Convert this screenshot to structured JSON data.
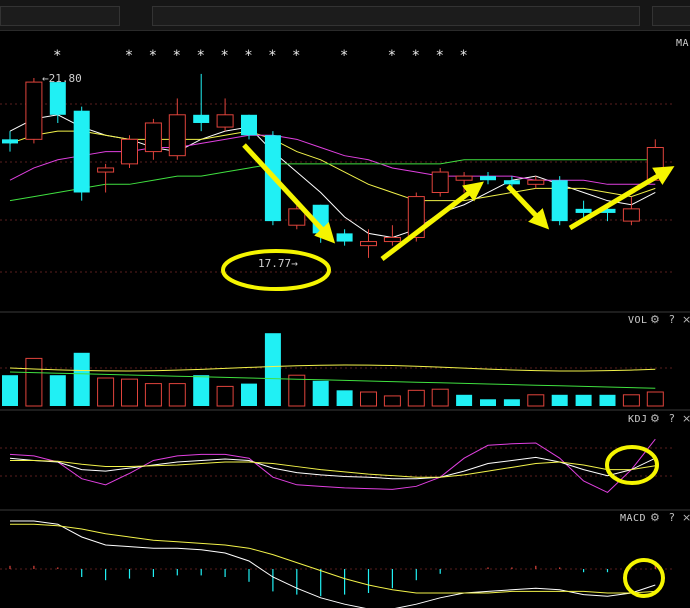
{
  "panels": {
    "main": {
      "label": "MA"
    },
    "vol": {
      "label": "VOL"
    },
    "kdj": {
      "label": "KDJ"
    },
    "macd": {
      "label": "MACD"
    }
  },
  "panel_controls": {
    "settings": "⚙",
    "help": "?",
    "close": "×"
  },
  "annotations": {
    "high_price": "21.80",
    "low_price": "17.77",
    "high_arrow": "←",
    "low_arrow": "→",
    "star": "*"
  },
  "colors": {
    "up": "#e0443c",
    "down": "#20f0f4",
    "ma_white": "#ffffff",
    "ma_yellow": "#f2f24a",
    "ma_magenta": "#e040e0",
    "ma_green": "#40e040",
    "highlight": "#f5f500",
    "grid": "#5a1e1e"
  },
  "chart_data": {
    "type": "candlestick",
    "candles": [
      {
        "o": 20.3,
        "c": 20.2,
        "h": 20.5,
        "l": 20.0,
        "dir": "down"
      },
      {
        "o": 20.3,
        "c": 21.7,
        "h": 21.8,
        "l": 20.2,
        "dir": "up"
      },
      {
        "o": 21.7,
        "c": 20.9,
        "h": 21.7,
        "l": 20.7,
        "dir": "down"
      },
      {
        "o": 21.0,
        "c": 19.0,
        "h": 21.1,
        "l": 18.8,
        "dir": "down"
      },
      {
        "o": 19.5,
        "c": 19.6,
        "h": 19.7,
        "l": 19.0,
        "dir": "up"
      },
      {
        "o": 19.7,
        "c": 20.3,
        "h": 20.4,
        "l": 19.6,
        "dir": "up"
      },
      {
        "o": 20.0,
        "c": 20.7,
        "h": 20.8,
        "l": 19.8,
        "dir": "up"
      },
      {
        "o": 19.9,
        "c": 20.9,
        "h": 21.3,
        "l": 19.8,
        "dir": "up"
      },
      {
        "o": 20.9,
        "c": 20.7,
        "h": 21.9,
        "l": 20.5,
        "dir": "down"
      },
      {
        "o": 20.6,
        "c": 20.9,
        "h": 21.3,
        "l": 20.5,
        "dir": "up"
      },
      {
        "o": 20.9,
        "c": 20.4,
        "h": 20.9,
        "l": 20.3,
        "dir": "down"
      },
      {
        "o": 20.4,
        "c": 18.3,
        "h": 20.5,
        "l": 18.2,
        "dir": "down"
      },
      {
        "o": 18.2,
        "c": 18.6,
        "h": 18.7,
        "l": 18.1,
        "dir": "up"
      },
      {
        "o": 18.7,
        "c": 18.0,
        "h": 18.7,
        "l": 17.77,
        "dir": "down"
      },
      {
        "o": 18.0,
        "c": 17.8,
        "h": 18.1,
        "l": 17.7,
        "dir": "down"
      },
      {
        "o": 17.7,
        "c": 17.8,
        "h": 18.1,
        "l": 17.4,
        "dir": "up"
      },
      {
        "o": 17.8,
        "c": 17.9,
        "h": 18.2,
        "l": 17.7,
        "dir": "up"
      },
      {
        "o": 17.9,
        "c": 18.9,
        "h": 19.0,
        "l": 17.8,
        "dir": "up"
      },
      {
        "o": 19.0,
        "c": 19.5,
        "h": 19.6,
        "l": 18.9,
        "dir": "up"
      },
      {
        "o": 19.3,
        "c": 19.4,
        "h": 19.5,
        "l": 19.0,
        "dir": "up"
      },
      {
        "o": 19.4,
        "c": 19.3,
        "h": 19.5,
        "l": 19.2,
        "dir": "down"
      },
      {
        "o": 19.3,
        "c": 19.2,
        "h": 19.4,
        "l": 19.0,
        "dir": "down"
      },
      {
        "o": 19.3,
        "c": 19.2,
        "h": 19.4,
        "l": 19.1,
        "dir": "up"
      },
      {
        "o": 19.3,
        "c": 18.3,
        "h": 19.4,
        "l": 18.2,
        "dir": "down"
      },
      {
        "o": 18.6,
        "c": 18.5,
        "h": 18.8,
        "l": 18.3,
        "dir": "down"
      },
      {
        "o": 18.6,
        "c": 18.5,
        "h": 18.7,
        "l": 18.3,
        "dir": "down"
      },
      {
        "o": 18.3,
        "c": 18.6,
        "h": 18.9,
        "l": 18.2,
        "dir": "up"
      },
      {
        "o": 19.3,
        "c": 20.1,
        "h": 20.3,
        "l": 19.3,
        "dir": "up"
      }
    ],
    "volume": [
      {
        "v": 0.55,
        "dir": "down"
      },
      {
        "v": 0.85,
        "dir": "up"
      },
      {
        "v": 0.55,
        "dir": "down"
      },
      {
        "v": 0.95,
        "dir": "down"
      },
      {
        "v": 0.5,
        "dir": "up"
      },
      {
        "v": 0.48,
        "dir": "up"
      },
      {
        "v": 0.4,
        "dir": "up"
      },
      {
        "v": 0.4,
        "dir": "up"
      },
      {
        "v": 0.55,
        "dir": "down"
      },
      {
        "v": 0.35,
        "dir": "up"
      },
      {
        "v": 0.4,
        "dir": "down"
      },
      {
        "v": 1.3,
        "dir": "down"
      },
      {
        "v": 0.55,
        "dir": "up"
      },
      {
        "v": 0.45,
        "dir": "down"
      },
      {
        "v": 0.28,
        "dir": "down"
      },
      {
        "v": 0.25,
        "dir": "up"
      },
      {
        "v": 0.18,
        "dir": "up"
      },
      {
        "v": 0.28,
        "dir": "up"
      },
      {
        "v": 0.3,
        "dir": "up"
      },
      {
        "v": 0.2,
        "dir": "down"
      },
      {
        "v": 0.12,
        "dir": "down"
      },
      {
        "v": 0.12,
        "dir": "down"
      },
      {
        "v": 0.2,
        "dir": "up"
      },
      {
        "v": 0.2,
        "dir": "down"
      },
      {
        "v": 0.2,
        "dir": "down"
      },
      {
        "v": 0.2,
        "dir": "down"
      },
      {
        "v": 0.2,
        "dir": "up"
      },
      {
        "v": 0.25,
        "dir": "up"
      }
    ],
    "kdj": {
      "k": [
        55,
        52,
        50,
        40,
        38,
        42,
        46,
        50,
        52,
        54,
        52,
        42,
        36,
        33,
        31,
        30,
        28,
        28,
        30,
        38,
        48,
        52,
        56,
        50,
        40,
        32,
        40,
        55
      ],
      "d": [
        52,
        52,
        51,
        47,
        44,
        44,
        45,
        46,
        48,
        50,
        50,
        48,
        44,
        40,
        37,
        34,
        32,
        30,
        30,
        33,
        38,
        43,
        48,
        50,
        46,
        40,
        40,
        45
      ],
      "j": [
        60,
        58,
        50,
        28,
        20,
        35,
        52,
        58,
        60,
        60,
        55,
        30,
        20,
        18,
        16,
        15,
        14,
        18,
        30,
        55,
        72,
        74,
        75,
        55,
        25,
        10,
        40,
        80
      ]
    },
    "macd": {
      "dif": [
        0.3,
        0.3,
        0.28,
        0.2,
        0.15,
        0.14,
        0.13,
        0.13,
        0.12,
        0.1,
        0.05,
        -0.05,
        -0.12,
        -0.18,
        -0.22,
        -0.25,
        -0.25,
        -0.22,
        -0.18,
        -0.15,
        -0.14,
        -0.13,
        -0.12,
        -0.13,
        -0.16,
        -0.17,
        -0.15,
        -0.1
      ],
      "dea": [
        0.28,
        0.28,
        0.27,
        0.25,
        0.22,
        0.2,
        0.18,
        0.17,
        0.16,
        0.15,
        0.13,
        0.09,
        0.04,
        -0.01,
        -0.06,
        -0.1,
        -0.13,
        -0.15,
        -0.15,
        -0.15,
        -0.15,
        -0.14,
        -0.14,
        -0.14,
        -0.14,
        -0.15,
        -0.15,
        -0.14
      ],
      "bar": [
        0.02,
        0.02,
        0.01,
        -0.05,
        -0.07,
        -0.06,
        -0.05,
        -0.04,
        -0.04,
        -0.05,
        -0.08,
        -0.14,
        -0.16,
        -0.17,
        -0.16,
        -0.15,
        -0.12,
        -0.07,
        -0.03,
        0.0,
        0.01,
        0.01,
        0.02,
        0.01,
        -0.02,
        -0.02,
        0.0,
        0.04
      ]
    },
    "ma_lines": {
      "ma5": [
        20.5,
        20.8,
        20.9,
        20.6,
        20.4,
        20.3,
        20.1,
        20.0,
        20.3,
        20.5,
        20.6,
        20.0,
        19.5,
        19.0,
        18.4,
        18.0,
        17.9,
        18.1,
        18.5,
        18.7,
        19.0,
        19.3,
        19.4,
        19.2,
        19.0,
        18.8,
        18.7,
        19.0
      ],
      "ma10": [
        20.2,
        20.4,
        20.5,
        20.5,
        20.4,
        20.3,
        20.3,
        20.3,
        20.3,
        20.4,
        20.5,
        20.3,
        20.0,
        19.8,
        19.5,
        19.2,
        19.0,
        18.8,
        18.8,
        18.8,
        18.9,
        19.0,
        19.1,
        19.1,
        19.1,
        19.0,
        18.9,
        19.1
      ],
      "ma20": [
        19.3,
        19.6,
        19.8,
        19.9,
        20.0,
        20.0,
        20.1,
        20.1,
        20.2,
        20.3,
        20.4,
        20.4,
        20.3,
        20.1,
        19.9,
        19.8,
        19.6,
        19.5,
        19.4,
        19.4,
        19.4,
        19.4,
        19.3,
        19.3,
        19.3,
        19.2,
        19.2,
        19.2
      ],
      "ma60": [
        18.8,
        18.9,
        19.0,
        19.1,
        19.2,
        19.2,
        19.3,
        19.4,
        19.4,
        19.5,
        19.6,
        19.7,
        19.7,
        19.7,
        19.7,
        19.7,
        19.7,
        19.7,
        19.7,
        19.8,
        19.8,
        19.8,
        19.8,
        19.8,
        19.8,
        19.8,
        19.8,
        19.8
      ]
    }
  }
}
